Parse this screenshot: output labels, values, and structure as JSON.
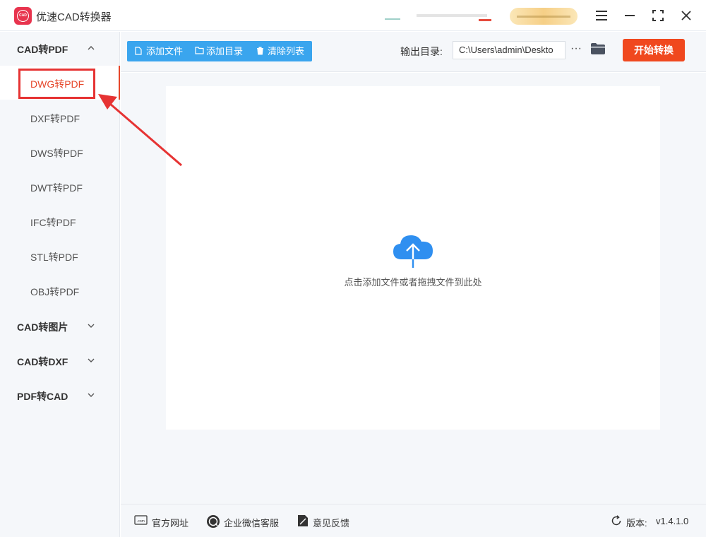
{
  "app": {
    "logo_text": "CAD",
    "title": "优速CAD转换器"
  },
  "window_controls": {
    "icons": [
      "menu-icon",
      "minimize-icon",
      "maximize-icon",
      "close-icon"
    ]
  },
  "sidebar": {
    "groups": [
      {
        "label": "CAD转PDF",
        "expanded": true,
        "items": [
          {
            "label": "DWG转PDF",
            "active": true
          },
          {
            "label": "DXF转PDF"
          },
          {
            "label": "DWS转PDF"
          },
          {
            "label": "DWT转PDF"
          },
          {
            "label": "IFC转PDF"
          },
          {
            "label": "STL转PDF"
          },
          {
            "label": "OBJ转PDF"
          }
        ]
      },
      {
        "label": "CAD转图片",
        "expanded": false
      },
      {
        "label": "CAD转DXF",
        "expanded": false
      },
      {
        "label": "PDF转CAD",
        "expanded": false
      }
    ]
  },
  "toolbar": {
    "add_file": "添加文件",
    "add_folder": "添加目录",
    "clear_list": "清除列表",
    "output_label": "输出目录:",
    "output_path": "C:\\Users\\admin\\Deskto",
    "more": "···",
    "start": "开始转换"
  },
  "dropzone": {
    "hint": "点击添加文件或者拖拽文件到此处"
  },
  "footer": {
    "website": "官方网址",
    "wechat": "企业微信客服",
    "feedback": "意见反馈",
    "version_label": "版本:",
    "version_value": "v1.4.1.0"
  },
  "colors": {
    "accent_red": "#f0481e",
    "toolbar_blue": "#3aa5ee",
    "cloud_blue": "#2f8ff0",
    "annotation_red": "#e63333"
  }
}
